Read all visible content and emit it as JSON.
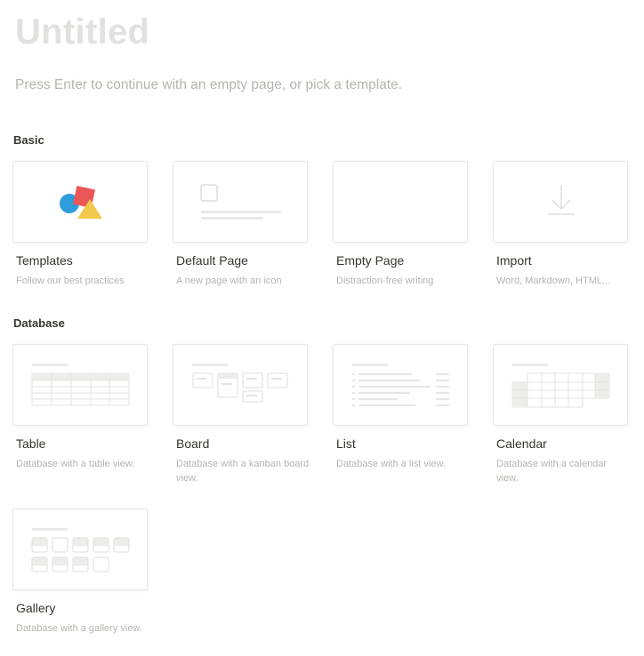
{
  "page": {
    "title": "Untitled",
    "hint": "Press Enter to continue with an empty page, or pick a template."
  },
  "sections": {
    "basic": {
      "label": "Basic",
      "items": [
        {
          "title": "Templates",
          "desc": "Follow our best practices",
          "icon": "templates-shapes-icon"
        },
        {
          "title": "Default Page",
          "desc": "A new page with an icon",
          "icon": "page-with-icon-icon"
        },
        {
          "title": "Empty Page",
          "desc": "Distraction-free writing",
          "icon": ""
        },
        {
          "title": "Import",
          "desc": "Word, Markdown, HTML...",
          "icon": "download-arrow-icon"
        }
      ]
    },
    "database": {
      "label": "Database",
      "items": [
        {
          "title": "Table",
          "desc": "Database with a table view.",
          "icon": "table-preview-icon"
        },
        {
          "title": "Board",
          "desc": "Database with a kanban board view.",
          "icon": "board-preview-icon"
        },
        {
          "title": "List",
          "desc": "Database with a list view.",
          "icon": "list-preview-icon"
        },
        {
          "title": "Calendar",
          "desc": "Database with a calendar view.",
          "icon": "calendar-preview-icon"
        },
        {
          "title": "Gallery",
          "desc": "Database with a gallery view.",
          "icon": "gallery-preview-icon"
        }
      ]
    }
  },
  "colors": {
    "red_square": "#eb5757",
    "blue_circle": "#2d9cdb",
    "yellow_triangle": "#f2c94c",
    "placeholder_gray": "#e9e9e7"
  }
}
